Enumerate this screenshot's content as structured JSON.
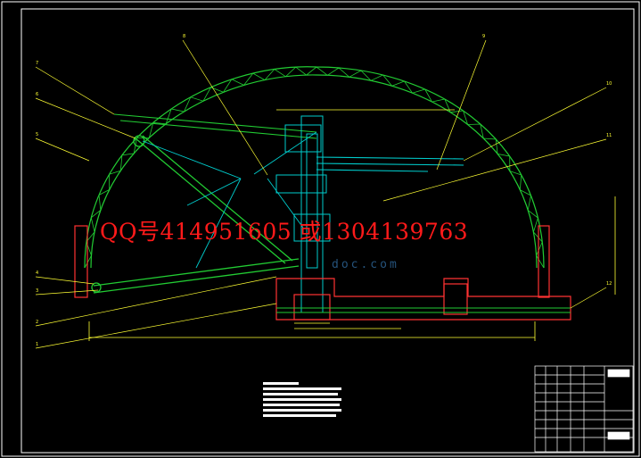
{
  "watermark_contact": "QQ号414951605 或1304139763",
  "watermark_site": "doc.com",
  "callouts": [
    "7",
    "6",
    "5",
    "4",
    "3",
    "2",
    "1",
    "8",
    "9",
    "10",
    "11",
    "12"
  ],
  "colors": {
    "background": "#000000",
    "arch_truss": "#22cc33",
    "boom": "#22cc33",
    "structure": "#00cccc",
    "dimension": "#ffff33",
    "leader": "#ffff33",
    "foundation": "#ff3333",
    "frame": "#ffffff",
    "watermark_contact": "#ff1a1a"
  }
}
